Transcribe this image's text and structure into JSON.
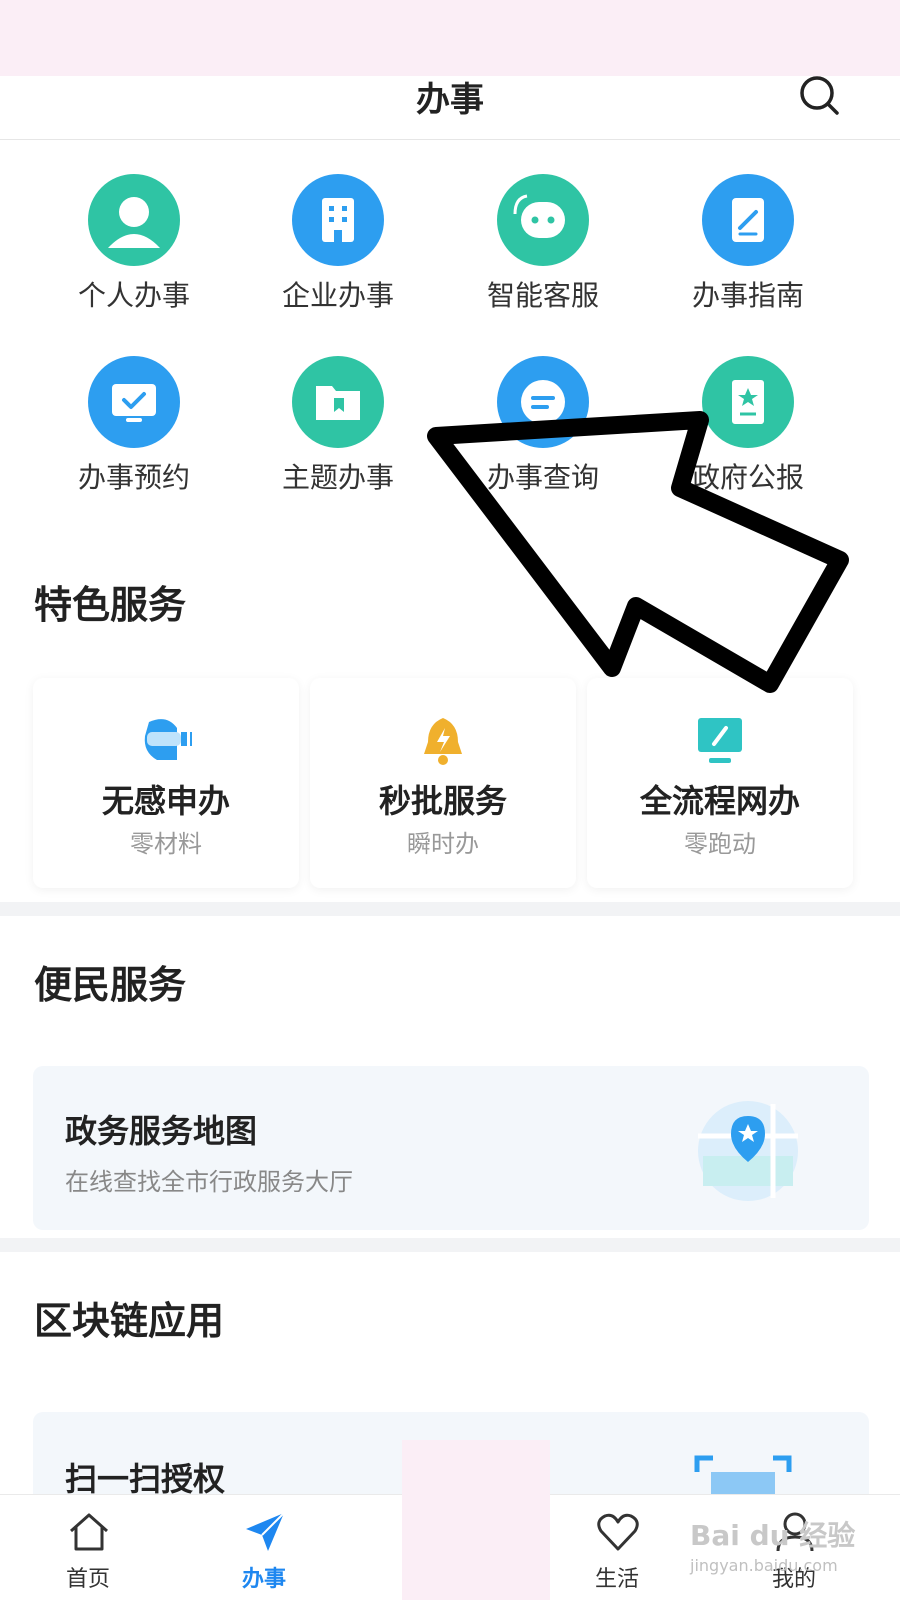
{
  "header": {
    "title": "办事"
  },
  "grid": [
    {
      "label": "个人办事",
      "icon": "person-icon",
      "color": "#2fc4a4"
    },
    {
      "label": "企业办事",
      "icon": "building-icon",
      "color": "#2d9ef0"
    },
    {
      "label": "智能客服",
      "icon": "chat-robot-icon",
      "color": "#2fc4a4"
    },
    {
      "label": "办事指南",
      "icon": "edit-doc-icon",
      "color": "#2d9ef0"
    },
    {
      "label": "办事预约",
      "icon": "monitor-check-icon",
      "color": "#2d9ef0"
    },
    {
      "label": "主题办事",
      "icon": "folder-icon",
      "color": "#2fc4a4"
    },
    {
      "label": "办事查询",
      "icon": "query-icon",
      "color": "#2d9ef0"
    },
    {
      "label": "政府公报",
      "icon": "gazette-icon",
      "color": "#2fc4a4"
    }
  ],
  "featured": {
    "title": "特色服务",
    "cards": [
      {
        "title": "无感申办",
        "subtitle": "零材料",
        "icon": "vr-headset-icon",
        "color": "#2d9ef0"
      },
      {
        "title": "秒批服务",
        "subtitle": "瞬时办",
        "icon": "bell-lightning-icon",
        "color": "#f0b02d"
      },
      {
        "title": "全流程网办",
        "subtitle": "零跑动",
        "icon": "monitor-edit-icon",
        "color": "#2fc4c4"
      }
    ]
  },
  "convenience": {
    "title": "便民服务",
    "card": {
      "title": "政务服务地图",
      "subtitle": "在线查找全市行政服务大厅",
      "icon": "map-pin-icon"
    }
  },
  "blockchain": {
    "title": "区块链应用",
    "card": {
      "title": "扫一扫授权",
      "icon": "scan-icon"
    }
  },
  "tabbar": {
    "items": [
      {
        "label": "首页",
        "icon": "home-icon",
        "active": false
      },
      {
        "label": "办事",
        "icon": "send-icon",
        "active": true
      },
      {
        "label": "生活",
        "icon": "heart-icon",
        "active": false
      },
      {
        "label": "我的",
        "icon": "user-icon",
        "active": false
      }
    ]
  },
  "watermark": {
    "top": "Bai du 经验",
    "bottom": "jingyan.baidu.com"
  },
  "colors": {
    "accent": "#1e87f0",
    "green": "#2fc4a4",
    "blue": "#2d9ef0"
  }
}
